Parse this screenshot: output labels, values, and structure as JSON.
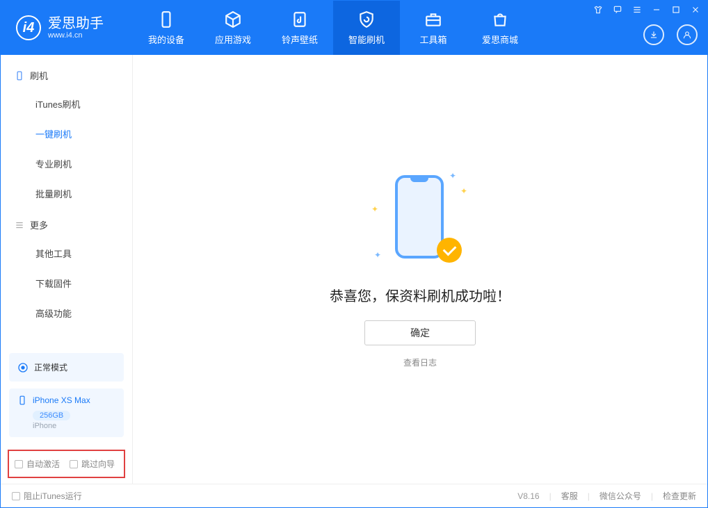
{
  "app": {
    "name": "爱思助手",
    "url": "www.i4.cn"
  },
  "nav": {
    "tabs": [
      {
        "id": "device",
        "label": "我的设备"
      },
      {
        "id": "apps",
        "label": "应用游戏"
      },
      {
        "id": "ringtones",
        "label": "铃声壁纸"
      },
      {
        "id": "flash",
        "label": "智能刷机"
      },
      {
        "id": "tools",
        "label": "工具箱"
      },
      {
        "id": "store",
        "label": "爱思商城"
      }
    ]
  },
  "sidebar": {
    "sections": {
      "flash": {
        "title": "刷机",
        "items": [
          {
            "id": "itunes",
            "label": "iTunes刷机"
          },
          {
            "id": "onekey",
            "label": "一键刷机"
          },
          {
            "id": "pro",
            "label": "专业刷机"
          },
          {
            "id": "batch",
            "label": "批量刷机"
          }
        ]
      },
      "more": {
        "title": "更多",
        "items": [
          {
            "id": "other",
            "label": "其他工具"
          },
          {
            "id": "fw",
            "label": "下载固件"
          },
          {
            "id": "adv",
            "label": "高级功能"
          }
        ]
      }
    },
    "mode": "正常模式",
    "device": {
      "name": "iPhone XS Max",
      "storage": "256GB",
      "type": "iPhone"
    },
    "options": {
      "auto_activate": "自动激活",
      "skip_setup": "跳过向导"
    }
  },
  "main": {
    "headline": "恭喜您，保资料刷机成功啦！",
    "ok": "确定",
    "view_log": "查看日志"
  },
  "status": {
    "block_itunes": "阻止iTunes运行",
    "version": "V8.16",
    "links": {
      "support": "客服",
      "wechat": "微信公众号",
      "update": "检查更新"
    }
  }
}
